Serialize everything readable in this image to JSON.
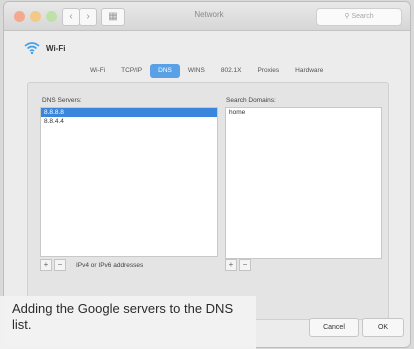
{
  "window": {
    "title": "Network",
    "search_placeholder": "Search",
    "nav_back": "‹",
    "nav_forward": "›",
    "grid": "▦"
  },
  "interface": {
    "name": "Wi-Fi",
    "icon": "wifi-icon"
  },
  "tabs": [
    {
      "label": "Wi-Fi",
      "active": false
    },
    {
      "label": "TCP/IP",
      "active": false
    },
    {
      "label": "DNS",
      "active": true
    },
    {
      "label": "WINS",
      "active": false
    },
    {
      "label": "802.1X",
      "active": false
    },
    {
      "label": "Proxies",
      "active": false
    },
    {
      "label": "Hardware",
      "active": false
    }
  ],
  "dns": {
    "label": "DNS Servers:",
    "servers": [
      "8.8.8.8",
      "8.8.4.4"
    ],
    "selected_index": 0,
    "hint": "IPv4 or IPv6 addresses",
    "add": "+",
    "remove": "−"
  },
  "search_domains": {
    "label": "Search Domains:",
    "domains": [
      "home"
    ],
    "add": "+",
    "remove": "−"
  },
  "buttons": {
    "cancel": "Cancel",
    "ok": "OK"
  },
  "caption": "Adding the Google servers to the DNS list.",
  "colors": {
    "accent": "#3a86dc",
    "active_tab": "#5aa0e6",
    "wifi": "#3fa0e8"
  }
}
